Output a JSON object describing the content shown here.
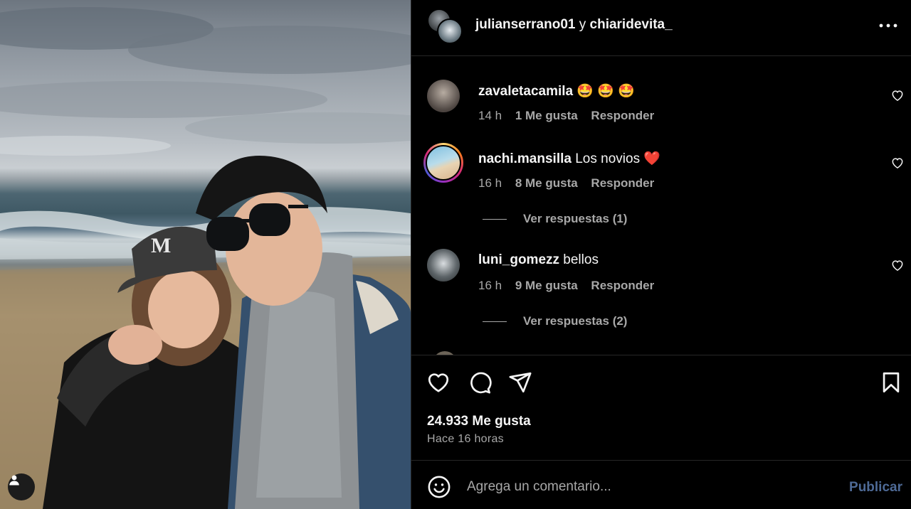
{
  "photo": {
    "alt_icon": "user-tag-icon"
  },
  "header": {
    "user1": "julianserrano01",
    "separator": "y",
    "user2": "chiaridevita_",
    "more_icon": "more-options-icon"
  },
  "comments": [
    {
      "user": "zavaletacamila",
      "text": "🤩 🤩 🤩",
      "time": "14 h",
      "likes": "1 Me gusta",
      "reply": "Responder"
    },
    {
      "user": "nachi.mansilla",
      "text": "Los novios ❤️",
      "time": "16 h",
      "likes": "8 Me gusta",
      "reply": "Responder",
      "view_replies": "Ver respuestas (1)"
    },
    {
      "user": "luni_gomezz",
      "text": "bellos",
      "time": "16 h",
      "likes": "9 Me gusta",
      "reply": "Responder",
      "view_replies": "Ver respuestas (2)"
    }
  ],
  "actions": {
    "icons": [
      "heart-icon",
      "comment-icon",
      "share-icon",
      "bookmark-icon"
    ],
    "likes_count": "24.933 Me gusta",
    "time_ago": "Hace 16 horas"
  },
  "add_comment": {
    "placeholder": "Agrega un comentario...",
    "publish_label": "Publicar"
  },
  "colors": {
    "background": "#000000",
    "text": "#f5f5f5",
    "muted": "#a8a8a8",
    "publish_disabled": "#4e6a96",
    "heart_red": "#ff3040"
  }
}
